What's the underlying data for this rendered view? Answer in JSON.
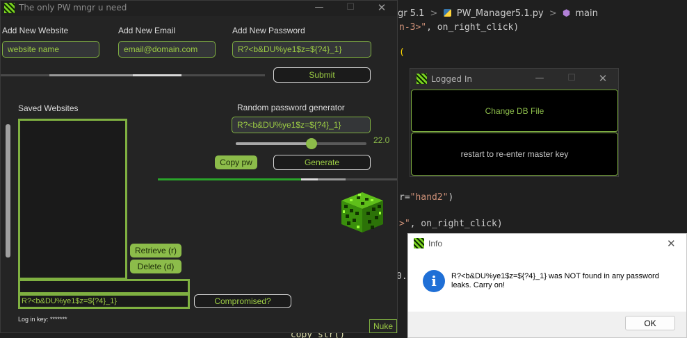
{
  "editor": {
    "breadcrumb": {
      "folder": "gr 5.1",
      "file": "PW_Manager5.1.py",
      "symbol": "main",
      "sep1": ">",
      "sep2": ">"
    },
    "lines": {
      "l1_str": "n-3>\"",
      "l1_rest": ", on_right_click)",
      "l2": "(",
      "l3_pre": "r=",
      "l3_str": "\"hand2\"",
      "l3_post": ")",
      "l4_str": ">\"",
      "l4_rest": ", on_right_click)",
      "l5": "0.",
      "l6": "_copy_str()"
    }
  },
  "main_window": {
    "title": "The only PW mngr u need",
    "controls": {
      "minimize": "—",
      "maximize": "☐",
      "close": "✕"
    },
    "labels": {
      "website": "Add New Website",
      "email": "Add New Email",
      "password": "Add New Password",
      "saved": "Saved Websites",
      "generator": "Random password generator",
      "login_key": "Log in key: *******"
    },
    "inputs": {
      "website_placeholder": "website name",
      "email_placeholder": "email@domain.com",
      "password_value": "R?<b&DU%ye1$z=${?4}_1}",
      "generated_value": "R?<b&DU%ye1$z=${?4}_1}",
      "compromised_value": "R?<b&DU%ye1$z=${?4}_1}"
    },
    "buttons": {
      "submit": "Submit",
      "copy": "Copy pw",
      "generate": "Generate",
      "retrieve": "Retrieve (r)",
      "delete": "Delete   (d)",
      "compromised": "Compromised?",
      "nuke": "Nuke"
    },
    "slider": {
      "value_label": "22.0",
      "fraction": 0.58
    },
    "colors": {
      "accent": "#8cbc4a",
      "text_green": "#9ccc44",
      "bg": "#242424"
    }
  },
  "login_window": {
    "title": "Logged In",
    "controls": {
      "minimize": "—",
      "maximize": "☐",
      "close": "✕"
    },
    "buttons": {
      "change_db": "Change DB File",
      "restart": "restart to re-enter master key"
    }
  },
  "info_dialog": {
    "title": "Info",
    "close": "✕",
    "icon_glyph": "i",
    "message": "R?<b&DU%ye1$z=${?4}_1} was NOT found in any password leaks. Carry on!",
    "ok": "OK"
  }
}
